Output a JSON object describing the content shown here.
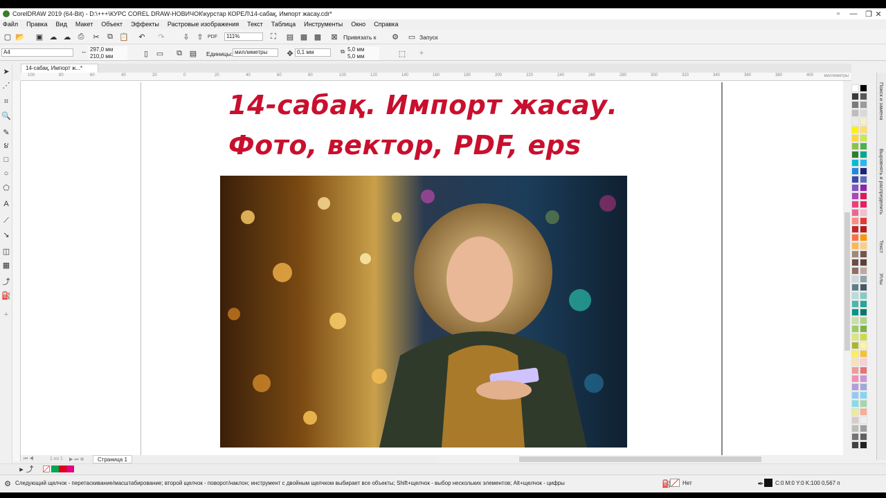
{
  "window": {
    "title": "CorelDRAW 2019 (64-Bit) - D:\\+++\\КУРС COREL DRAW-НОВИЧОК\\курстар КОРЕЛ\\14-сабақ, Импорт жасау.cdr*"
  },
  "menu": [
    "Файл",
    "Правка",
    "Вид",
    "Макет",
    "Объект",
    "Эффекты",
    "Растровые изображения",
    "Текст",
    "Таблица",
    "Инструменты",
    "Окно",
    "Справка"
  ],
  "toolbar1": {
    "zoom": "111%",
    "snap_label": "Привязать к",
    "launch_label": "Запуск"
  },
  "toolbar2": {
    "page_size": "A4",
    "width": "297,0 мм",
    "height": "210,0 мм",
    "units_label": "Единицы:",
    "units_value": "миллиметры",
    "nudge": "0,1 мм",
    "dup_x": "5,0 мм",
    "dup_y": "5,0 мм"
  },
  "doc": {
    "tab_label": "14-сабақ, Импорт ж...*",
    "ruler_units": "миллиметры"
  },
  "ruler_ticks": [
    "100",
    "80",
    "60",
    "40",
    "20",
    "0",
    "20",
    "40",
    "60",
    "80",
    "100",
    "120",
    "140",
    "160",
    "180",
    "200",
    "220",
    "240",
    "260",
    "280",
    "300",
    "320",
    "340",
    "360",
    "380",
    "400"
  ],
  "content": {
    "heading1": "14-сабақ. Импорт жасау.",
    "heading2": "Фото, вектор, PDF, eps"
  },
  "pagenav": {
    "counter": "1 из 1",
    "page_tab": "Страница 1"
  },
  "dockers": [
    "Поиск и замена",
    "Выровнять и распределить",
    "Текст",
    "Углы"
  ],
  "status": {
    "hint": "Следующий щелчок - перетаскивание/масштабирование; второй щелчок - поворот/наклон; инструмент с двойным щелчком выбирает все объекты; Shift+щелчок - выбор нескольких элементов; Alt+щелчок - цифры",
    "fill": "Нет",
    "outline": "C:0 M:0 Y:0 K:100  0,567 п"
  },
  "colors": {
    "heading": "#c8102e"
  },
  "palette": [
    "#ffffff",
    "#000000",
    "#3a3a3a",
    "#595959",
    "#7a7a7a",
    "#9b9b9b",
    "#bdbdbd",
    "#d9d9d9",
    "#ececec",
    "#f5f0c8",
    "#fff200",
    "#ffe066",
    "#fdd835",
    "#c6e94b",
    "#8bc34a",
    "#4caf50",
    "#2e7d32",
    "#00a98f",
    "#00bcd4",
    "#29b6f6",
    "#1e88e5",
    "#1a237e",
    "#3949ab",
    "#5c6bc0",
    "#7e57c2",
    "#8e24aa",
    "#ab47bc",
    "#d81b60",
    "#ec407a",
    "#e91e63",
    "#f06292",
    "#f8bbd0",
    "#ff8a80",
    "#e53935",
    "#c62828",
    "#b71c1c",
    "#ff7043",
    "#ff9800",
    "#ffb74d",
    "#ffcc80",
    "#a1887f",
    "#795548",
    "#6d4c41",
    "#5d4037",
    "#8d6e63",
    "#bcaaa4",
    "#cfd8dc",
    "#90a4ae",
    "#607d8b",
    "#455a64",
    "#b2dfdb",
    "#80cbc4",
    "#4db6ac",
    "#26a69a",
    "#009688",
    "#00796b",
    "#c5e1a5",
    "#aed581",
    "#9ccc65",
    "#7cb342",
    "#dce775",
    "#cddc39",
    "#afb42b",
    "#fff59d",
    "#ffee58",
    "#fbc02d",
    "#ffe0b2",
    "#ffcdd2",
    "#ef9a9a",
    "#e57373",
    "#f48fb1",
    "#ce93d8",
    "#b39ddb",
    "#9fa8da",
    "#90caf9",
    "#81d4fa",
    "#80deea",
    "#a5d6a7",
    "#e6ee9c",
    "#ffab91",
    "#d7ccc8",
    "#eeeeee",
    "#bdbdbd",
    "#9e9e9e",
    "#757575",
    "#616161",
    "#424242",
    "#212121"
  ],
  "recent_colors": [
    "#00a651",
    "#e2001a",
    "#e6007e"
  ]
}
